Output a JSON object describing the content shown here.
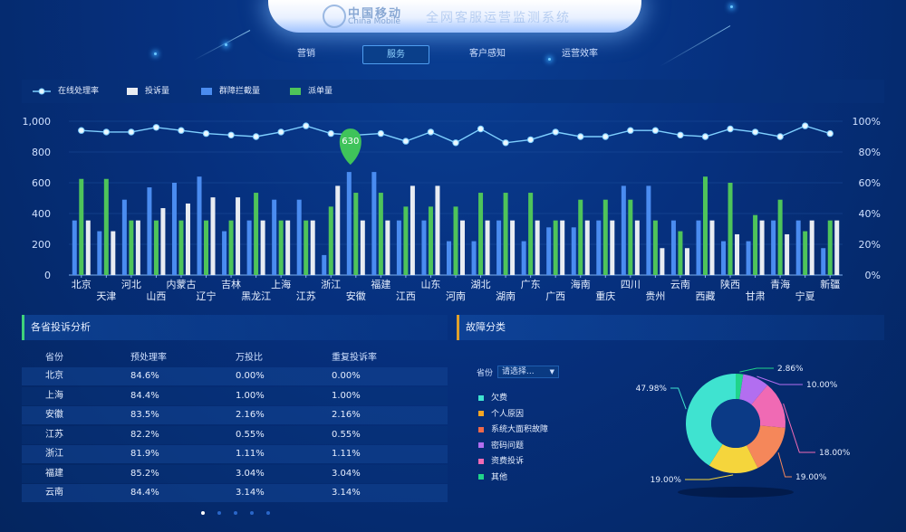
{
  "header": {
    "logo_cn": "中国移动",
    "logo_en": "China Mobile",
    "title": "全网客服运营监测系统"
  },
  "nav": {
    "tabs": [
      {
        "label": "营销",
        "active": false
      },
      {
        "label": "服务",
        "active": true
      },
      {
        "label": "客户感知",
        "active": false
      },
      {
        "label": "运营效率",
        "active": false
      }
    ]
  },
  "legend": [
    {
      "label": "在线处理率",
      "color": "#7fd0ff",
      "kind": "line"
    },
    {
      "label": "投诉量",
      "color": "#e8ecf2",
      "kind": "bar"
    },
    {
      "label": "群障拦截量",
      "color": "#4a8cf0",
      "kind": "bar"
    },
    {
      "label": "派单量",
      "color": "#4ec45a",
      "kind": "bar"
    }
  ],
  "chart_data": {
    "type": "bar",
    "categories": [
      "北京",
      "天津",
      "河北",
      "山西",
      "内蒙古",
      "辽宁",
      "吉林",
      "黑龙江",
      "上海",
      "江苏",
      "浙江",
      "安徽",
      "福建",
      "江西",
      "山东",
      "河南",
      "湖北",
      "湖南",
      "广东",
      "广西",
      "海南",
      "重庆",
      "四川",
      "贵州",
      "云南",
      "西藏",
      "陕西",
      "甘肃",
      "青海",
      "宁夏",
      "新疆"
    ],
    "series": [
      {
        "name": "群障拦截量",
        "color": "#4a8cf0",
        "values": [
          355,
          285,
          490,
          570,
          600,
          640,
          285,
          355,
          490,
          490,
          130,
          670,
          670,
          355,
          355,
          220,
          220,
          355,
          220,
          310,
          310,
          355,
          580,
          580,
          355,
          355,
          220,
          220,
          355,
          355,
          175
        ]
      },
      {
        "name": "派单量",
        "color": "#4ec45a",
        "values": [
          625,
          625,
          355,
          355,
          355,
          355,
          355,
          535,
          355,
          355,
          445,
          535,
          535,
          445,
          445,
          445,
          535,
          535,
          535,
          355,
          490,
          490,
          490,
          355,
          285,
          640,
          600,
          390,
          490,
          285,
          355
        ]
      },
      {
        "name": "投诉量",
        "color": "#e8ecf2",
        "values": [
          355,
          285,
          355,
          435,
          465,
          505,
          505,
          355,
          355,
          355,
          580,
          355,
          355,
          580,
          580,
          355,
          355,
          355,
          355,
          355,
          355,
          355,
          355,
          175,
          175,
          355,
          265,
          355,
          265,
          355,
          355
        ]
      },
      {
        "name": "在线处理率",
        "color": "#7fd0ff",
        "axis": "right",
        "values": [
          94,
          93,
          93,
          96,
          94,
          92,
          91,
          90,
          93,
          97,
          92,
          91,
          92,
          87,
          93,
          86,
          95,
          86,
          88,
          93,
          90,
          90,
          94,
          94,
          91,
          90,
          95,
          93,
          90,
          97,
          92
        ]
      }
    ],
    "y_left": {
      "ticks": [
        "0",
        "200",
        "400",
        "600",
        "800",
        "1,000"
      ],
      "ylim": [
        0,
        1000
      ]
    },
    "y_right": {
      "ticks": [
        "0%",
        "20%",
        "40%",
        "60%",
        "80%",
        "100%"
      ],
      "ylim": [
        0,
        100
      ]
    },
    "tooltip": {
      "category": "安徽",
      "label": "630"
    },
    "grid": true,
    "legend_placement": "top-left"
  },
  "complaint_panel": {
    "title": "各省投诉分析",
    "accent": "#3fd27a",
    "columns": [
      "省份",
      "预处理率",
      "万投比",
      "重复投诉率"
    ],
    "rows": [
      [
        "北京",
        "84.6%",
        "0.00%",
        "0.00%"
      ],
      [
        "上海",
        "84.4%",
        "1.00%",
        "1.00%"
      ],
      [
        "安徽",
        "83.5%",
        "2.16%",
        "2.16%"
      ],
      [
        "江苏",
        "82.2%",
        "0.55%",
        "0.55%"
      ],
      [
        "浙江",
        "81.9%",
        "1.11%",
        "1.11%"
      ],
      [
        "福建",
        "85.2%",
        "3.04%",
        "3.04%"
      ],
      [
        "云南",
        "84.4%",
        "3.14%",
        "3.14%"
      ]
    ],
    "pager": {
      "pages": 5,
      "current": 1
    }
  },
  "fault_panel": {
    "title": "故障分类",
    "accent": "#e0a02a",
    "province_label": "省份",
    "province_placeholder": "请选择...",
    "categories": [
      {
        "label": "欠费",
        "color": "#3fe3d0"
      },
      {
        "label": "个人原因",
        "color": "#f5a623"
      },
      {
        "label": "系统大面积故障",
        "color": "#f06a4a"
      },
      {
        "label": "密码问题",
        "color": "#b26ef0"
      },
      {
        "label": "资费投诉",
        "color": "#f06ab4"
      },
      {
        "label": "其他",
        "color": "#20d48a"
      }
    ],
    "donut": {
      "slices": [
        {
          "value": 2.86,
          "label": "2.86%",
          "color": "#20d48a"
        },
        {
          "value": 10.0,
          "label": "10.00%",
          "color": "#b26ef0"
        },
        {
          "value": 18.0,
          "label": "18.00%",
          "color": "#f06ab4"
        },
        {
          "value": 19.0,
          "label": "19.00%",
          "color": "#f5875a"
        },
        {
          "value": 19.0,
          "label": "19.00%",
          "color": "#f5d53c"
        },
        {
          "value": 47.98,
          "label": "47.98%",
          "color": "#3fe3d0"
        }
      ]
    }
  }
}
